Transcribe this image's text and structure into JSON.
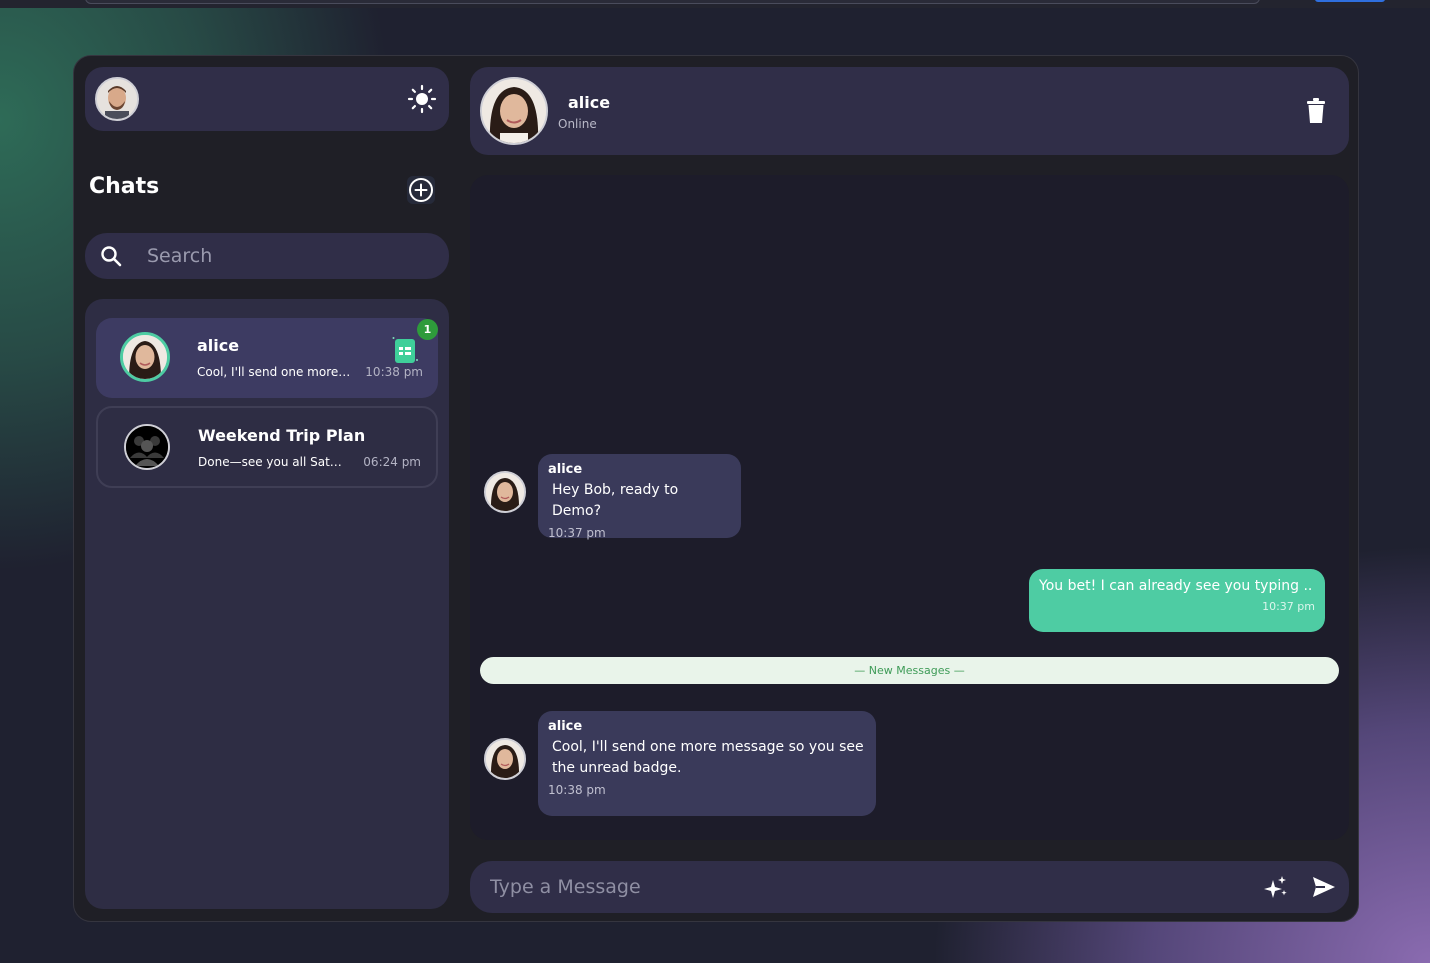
{
  "sidebar": {
    "title": "Chats",
    "search_placeholder": "Search",
    "chats": [
      {
        "name": "alice",
        "preview": "Cool, I'll send one more message so you see the unread badge.",
        "time": "10:38 pm",
        "unread": "1"
      },
      {
        "name": "Weekend Trip Plan",
        "preview": "Done—see you all Saturday!",
        "time": "06:24 pm"
      }
    ]
  },
  "header": {
    "name": "alice",
    "status": "Online"
  },
  "messages": [
    {
      "sender": "alice",
      "text": "Hey Bob, ready to Demo?",
      "time": "10:37 pm"
    },
    {
      "text": "You bet! I can already see you typing ..",
      "time": "10:37 pm"
    },
    {
      "sender": "alice",
      "text": "Cool, I'll send one more message so you see the unread badge.",
      "time": "10:38 pm"
    }
  ],
  "divider": "— New Messages —",
  "composer": {
    "placeholder": "Type a Message"
  },
  "colors": {
    "accent": "#4ecca3",
    "panel": "#302e48",
    "badge": "#2e9b3b"
  }
}
